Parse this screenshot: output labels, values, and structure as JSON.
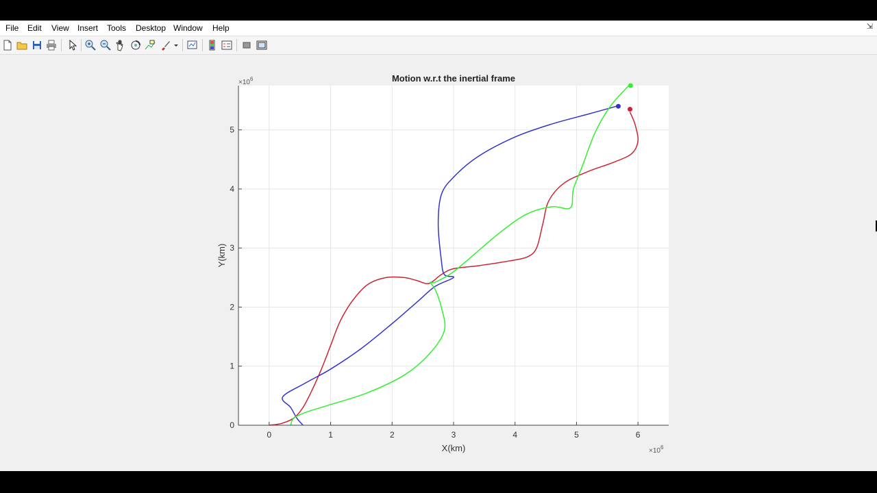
{
  "menu": [
    "File",
    "Edit",
    "View",
    "Insert",
    "Tools",
    "Desktop",
    "Window",
    "Help"
  ],
  "toolbar_icons": [
    "new-figure-icon",
    "open-file-icon",
    "save-icon",
    "print-icon",
    "pointer-icon",
    "zoom-in-icon",
    "zoom-out-icon",
    "pan-icon",
    "rotate-icon",
    "data-cursor-icon",
    "brush-icon",
    "brush-dropdown-icon",
    "link-plot-icon",
    "insert-colorbar-icon",
    "insert-legend-icon",
    "hide-plot-tools-icon",
    "show-plot-tools-icon"
  ],
  "chart_data": {
    "type": "line",
    "title": "Motion w.r.t the inertial frame",
    "xlabel": "X(km)",
    "ylabel": "Y(km)",
    "x_multiplier": "×10",
    "y_multiplier": "×10",
    "exponent": "6",
    "xlim": [
      -0.5,
      6.5
    ],
    "ylim": [
      0,
      5.75
    ],
    "xticks": [
      0,
      1,
      2,
      3,
      4,
      5,
      6
    ],
    "yticks": [
      0,
      1,
      2,
      3,
      4,
      5
    ],
    "grid": true,
    "series": [
      {
        "color": "#cc2233",
        "points": [
          [
            0.0,
            0.0
          ],
          [
            0.2,
            0.03
          ],
          [
            0.4,
            0.12
          ],
          [
            0.55,
            0.3
          ],
          [
            0.7,
            0.6
          ],
          [
            0.85,
            0.95
          ],
          [
            1.0,
            1.35
          ],
          [
            1.15,
            1.75
          ],
          [
            1.35,
            2.1
          ],
          [
            1.6,
            2.38
          ],
          [
            1.9,
            2.5
          ],
          [
            2.2,
            2.5
          ],
          [
            2.4,
            2.45
          ],
          [
            2.6,
            2.4
          ],
          [
            2.8,
            2.55
          ],
          [
            3.0,
            2.65
          ],
          [
            3.4,
            2.7
          ],
          [
            3.9,
            2.78
          ],
          [
            4.2,
            2.85
          ],
          [
            4.35,
            3.0
          ],
          [
            4.45,
            3.4
          ],
          [
            4.55,
            3.8
          ],
          [
            4.8,
            4.1
          ],
          [
            5.2,
            4.3
          ],
          [
            5.6,
            4.45
          ],
          [
            5.9,
            4.6
          ],
          [
            6.0,
            4.82
          ],
          [
            5.95,
            5.1
          ],
          [
            5.87,
            5.3
          ]
        ],
        "endpoint": [
          5.87,
          5.35
        ]
      },
      {
        "color": "#3333cc",
        "points": [
          [
            0.55,
            0.0
          ],
          [
            0.45,
            0.12
          ],
          [
            0.35,
            0.3
          ],
          [
            0.22,
            0.48
          ],
          [
            0.6,
            0.72
          ],
          [
            1.0,
            0.95
          ],
          [
            1.5,
            1.3
          ],
          [
            2.0,
            1.72
          ],
          [
            2.4,
            2.08
          ],
          [
            2.7,
            2.35
          ],
          [
            3.0,
            2.5
          ],
          [
            2.85,
            2.55
          ],
          [
            2.8,
            2.8
          ],
          [
            2.75,
            3.4
          ],
          [
            2.8,
            3.9
          ],
          [
            3.0,
            4.2
          ],
          [
            3.4,
            4.55
          ],
          [
            4.0,
            4.88
          ],
          [
            4.6,
            5.1
          ],
          [
            5.2,
            5.27
          ],
          [
            5.65,
            5.4
          ]
        ],
        "endpoint": [
          5.68,
          5.4
        ]
      },
      {
        "color": "#33ee33",
        "points": [
          [
            0.35,
            0.0
          ],
          [
            0.4,
            0.12
          ],
          [
            0.6,
            0.22
          ],
          [
            1.0,
            0.35
          ],
          [
            1.6,
            0.55
          ],
          [
            2.2,
            0.85
          ],
          [
            2.6,
            1.2
          ],
          [
            2.85,
            1.6
          ],
          [
            2.8,
            2.0
          ],
          [
            2.7,
            2.3
          ],
          [
            2.62,
            2.42
          ],
          [
            2.7,
            2.42
          ],
          [
            3.0,
            2.6
          ],
          [
            3.4,
            2.95
          ],
          [
            3.8,
            3.3
          ],
          [
            4.2,
            3.58
          ],
          [
            4.6,
            3.7
          ],
          [
            4.9,
            3.68
          ],
          [
            4.95,
            4.0
          ],
          [
            5.1,
            4.4
          ],
          [
            5.3,
            4.95
          ],
          [
            5.55,
            5.4
          ],
          [
            5.85,
            5.75
          ]
        ],
        "endpoint": [
          5.88,
          5.75
        ]
      }
    ]
  }
}
